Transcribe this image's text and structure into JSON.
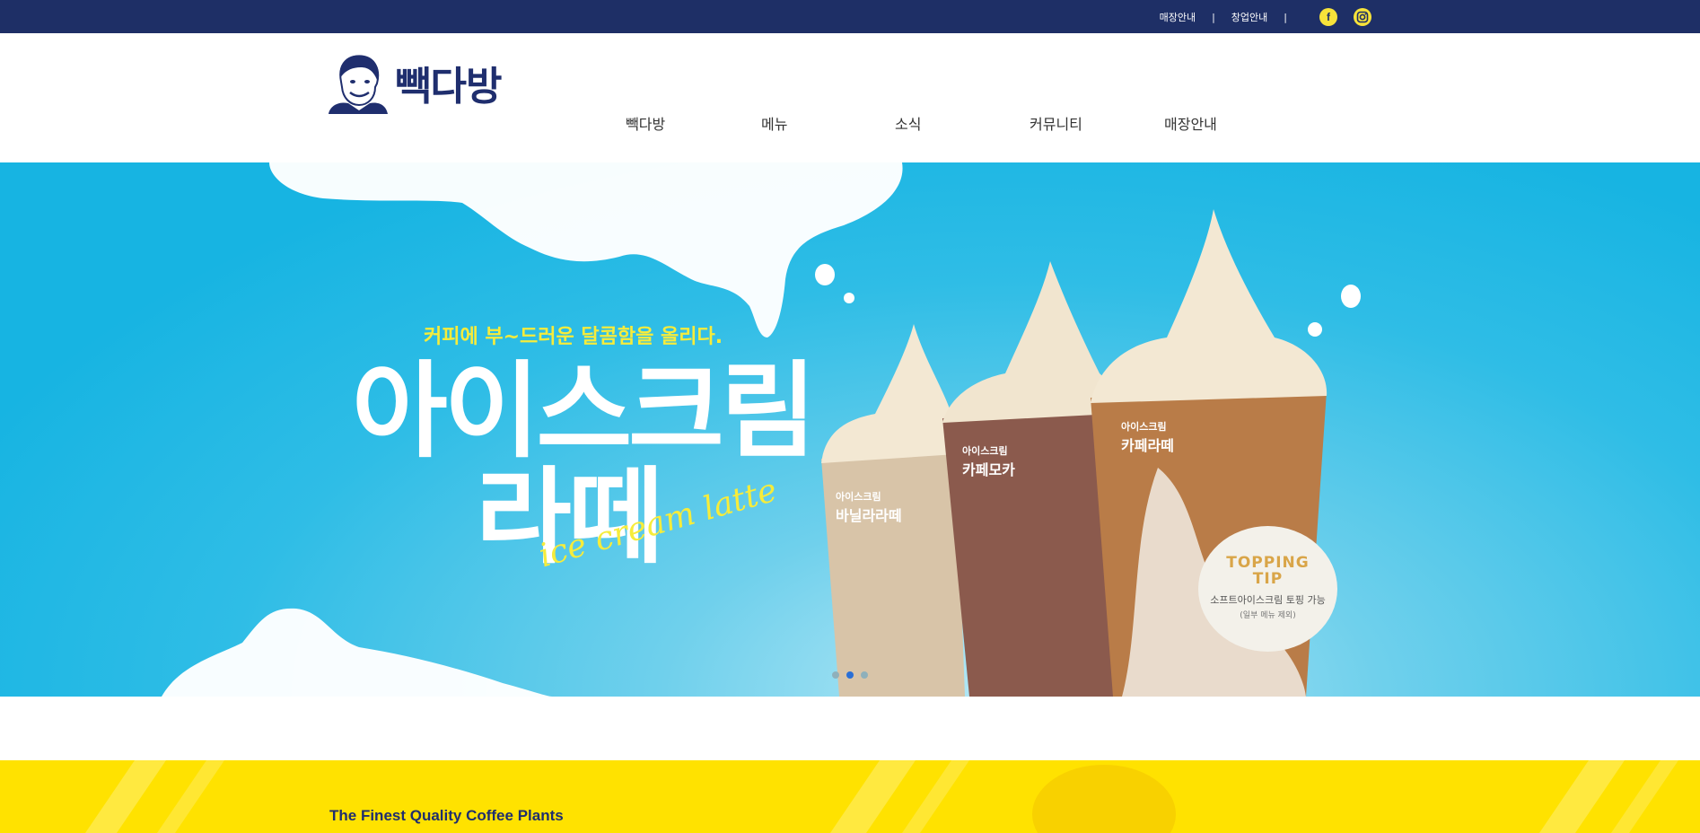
{
  "topbar": {
    "links": [
      "매장안내",
      "창업안내"
    ],
    "separator": "|",
    "social": [
      {
        "icon": "facebook-icon",
        "glyph": "f",
        "color": "#f7e33a"
      },
      {
        "icon": "instagram-icon",
        "color": "#f7e33a"
      }
    ],
    "bg_color": "#1e2f66"
  },
  "header": {
    "logo_text": "빽다방",
    "nav": [
      "빽다방",
      "메뉴",
      "소식",
      "커뮤니티",
      "매장안내"
    ]
  },
  "hero": {
    "subtitle": "커피에 부~드러운 달콤함을 올리다.",
    "title_line1": "아이스크림",
    "title_line2": "라떼",
    "script": "ice cream latte",
    "cups": [
      {
        "small": "아이스크림",
        "name": "바닐라라떼"
      },
      {
        "small": "아이스크림",
        "name": "카페모카"
      },
      {
        "small": "아이스크림",
        "name": "카페라떼"
      }
    ],
    "tip": {
      "title_line1": "TOPPING",
      "title_line2": "TIP",
      "desc": "소프트아이스크림 토핑 가능",
      "note": "(일부 메뉴 제외)"
    },
    "slides": {
      "count": 3,
      "active": 2
    },
    "accent_color": "#f6ec3b"
  },
  "section": {
    "title": "The Finest Quality Coffee Plants",
    "bg_color": "#ffe200"
  }
}
